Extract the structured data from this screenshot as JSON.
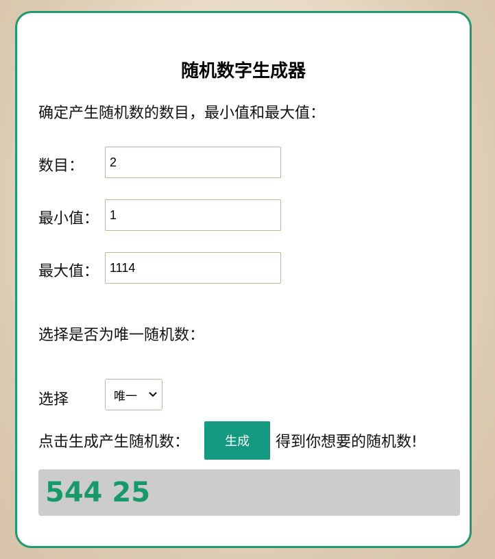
{
  "title": "随机数字生成器",
  "instruction": "确定产生随机数的数目，最小值和最大值：",
  "fields": {
    "count": {
      "label": "数目：",
      "value": "2"
    },
    "min": {
      "label": "最小值：",
      "value": "1"
    },
    "max": {
      "label": "最大值：",
      "value": "1114"
    }
  },
  "unique_prompt": "选择是否为唯一随机数：",
  "choose_label": "选择",
  "select": {
    "selected": "唯一"
  },
  "generate": {
    "prefix": "点击生成产生随机数：",
    "button_label": "生成",
    "suffix": "得到你想要的随机数!"
  },
  "result": "544 25",
  "colors": {
    "accent": "#1f9c6e",
    "button": "#139a80",
    "result_text": "#179a6b",
    "result_bg": "#cccccc"
  }
}
